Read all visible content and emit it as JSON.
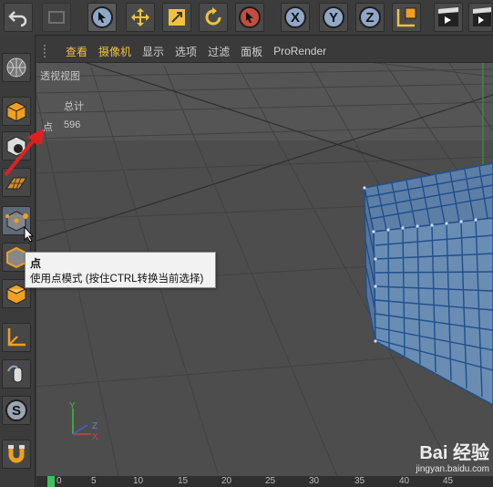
{
  "viewport": {
    "menu": [
      {
        "label": "查看",
        "highlight": true
      },
      {
        "label": "摄像机",
        "highlight": true
      },
      {
        "label": "显示",
        "highlight": false
      },
      {
        "label": "选项",
        "highlight": false
      },
      {
        "label": "过滤",
        "highlight": false
      },
      {
        "label": "面板",
        "highlight": false
      },
      {
        "label": "ProRender",
        "highlight": false
      }
    ],
    "view_name": "透视视图",
    "stats_header": "总计",
    "stats_label": "点",
    "stats_value": "596",
    "axis_labels": {
      "y": "Y",
      "z": "Z",
      "x": "X"
    }
  },
  "toolbar": {
    "axis_x": "X",
    "axis_y": "Y",
    "axis_z": "Z",
    "undo_icon": "undo-icon",
    "redo_icon": "redo-icon"
  },
  "tooltip": {
    "title": "点",
    "description": "使用点模式 (按住CTRL转换当前选择)"
  },
  "timeline": {
    "ticks": [
      "0",
      "5",
      "10",
      "15",
      "20",
      "25",
      "30",
      "35",
      "40",
      "45"
    ]
  },
  "watermark": {
    "line1": "Bai 经验",
    "line2": "jingyan.baidu.com"
  },
  "colors": {
    "accent_yellow": "#f0c23e",
    "icon_blue": "#8fa8c9",
    "cube_edge": "#1f4f8f",
    "grid_line": "#3d3d3d"
  }
}
